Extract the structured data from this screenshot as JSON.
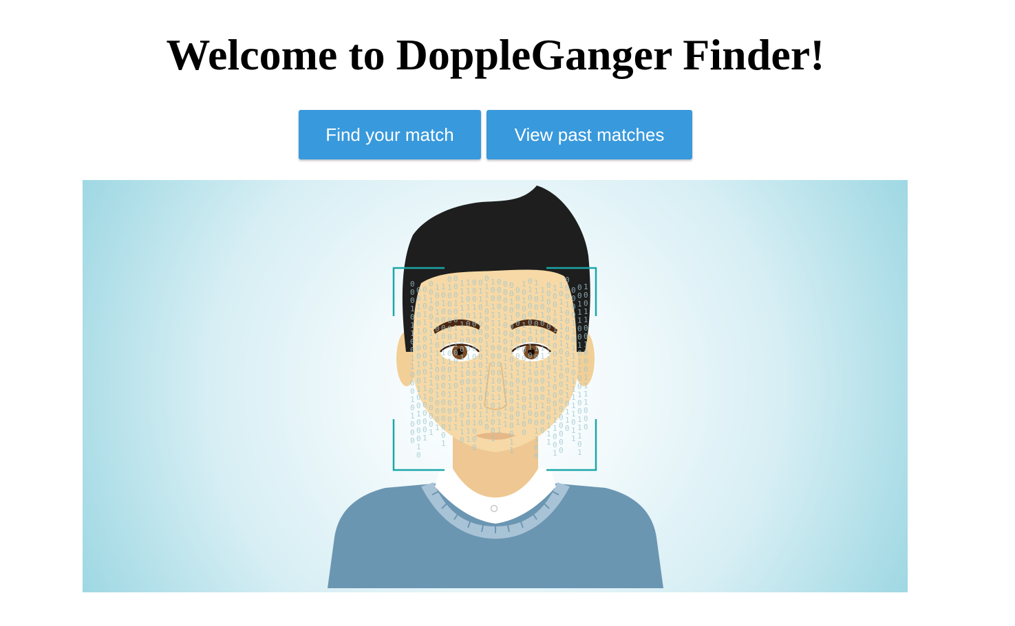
{
  "header": {
    "title": "Welcome to DoppleGanger Finder!"
  },
  "actions": {
    "find_match_label": "Find your match",
    "view_past_label": "View past matches"
  },
  "hero": {
    "illustration": "face-recognition-scan",
    "binary_digits": [
      "0",
      "1"
    ]
  },
  "colors": {
    "button": "#3899dc",
    "button_text": "#ffffff",
    "hero_edge": "#98d5e1",
    "hero_center": "#ffffff",
    "scan_frame": "#1aa6a8",
    "hair": "#1e1e1e",
    "skin": "#f6d9a6",
    "sweater": "#6b96b2",
    "collar": "#ffffff"
  }
}
